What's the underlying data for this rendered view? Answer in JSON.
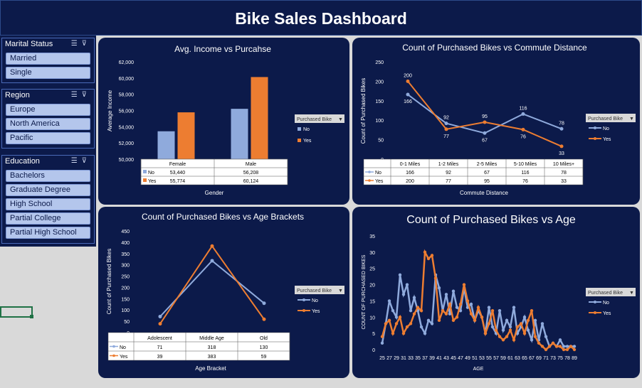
{
  "dashboard": {
    "title": "Bike Sales Dashboard"
  },
  "slicers": [
    {
      "title": "Marital Status",
      "items": [
        "Married",
        "Single"
      ]
    },
    {
      "title": "Region",
      "items": [
        "Europe",
        "North America",
        "Pacific"
      ]
    },
    {
      "title": "Education",
      "items": [
        "Bachelors",
        "Graduate Degree",
        "High School",
        "Partial College",
        "Partial High School"
      ]
    }
  ],
  "legend_button": "Purchased Bike",
  "colors": {
    "no": "#8faadc",
    "yes": "#ed7d31",
    "panel": "#0c1a4a",
    "text": "#ffffff"
  },
  "chart_data": [
    {
      "type": "bar",
      "title": "Avg. Income vs Purcahse",
      "xlabel": "Gender",
      "ylabel": "Average Income",
      "categories": [
        "Female",
        "Male"
      ],
      "series": [
        {
          "name": "No",
          "values": [
            53440,
            56208
          ],
          "labels": [
            "53,440",
            "56,208"
          ]
        },
        {
          "name": "Yes",
          "values": [
            55774,
            60124
          ],
          "labels": [
            "55,774",
            "60,124"
          ]
        }
      ],
      "ylim": [
        50000,
        62000
      ],
      "yticks": [
        "50,000",
        "52,000",
        "54,000",
        "56,000",
        "58,000",
        "60,000",
        "62,000"
      ],
      "legend": "right"
    },
    {
      "type": "line",
      "title": "Count of Purchased Bikes vs Commute Distance",
      "xlabel": "Commute Distance",
      "ylabel": "Count of Purchased Bikes",
      "categories": [
        "0-1 Miles",
        "1-2 Miles",
        "2-5 Miles",
        "5-10 Miles",
        "10 Miles+"
      ],
      "series": [
        {
          "name": "No",
          "values": [
            166,
            92,
            67,
            116,
            78
          ]
        },
        {
          "name": "Yes",
          "values": [
            200,
            77,
            95,
            76,
            33
          ]
        }
      ],
      "ylim": [
        0,
        250
      ],
      "yticks": [
        "0",
        "50",
        "100",
        "150",
        "200",
        "250"
      ],
      "legend": "right"
    },
    {
      "type": "line",
      "title": "Count of Purchased Bikes vs Age Brackets",
      "xlabel": "Age Bracket",
      "ylabel": "Count of Purchased Bikes",
      "categories": [
        "Adolescent",
        "Middle Age",
        "Old"
      ],
      "series": [
        {
          "name": "No",
          "values": [
            71,
            318,
            130
          ]
        },
        {
          "name": "Yes",
          "values": [
            39,
            383,
            59
          ]
        }
      ],
      "ylim": [
        0,
        450
      ],
      "yticks": [
        "0",
        "50",
        "100",
        "150",
        "200",
        "250",
        "300",
        "350",
        "400",
        "450"
      ],
      "legend": "right"
    },
    {
      "type": "line",
      "title": "Count of Purchased Bikes vs Age",
      "xlabel": "AGE",
      "ylabel": "COUNT OF PURCHASED BIKES",
      "x": [
        25,
        26,
        27,
        28,
        29,
        30,
        31,
        32,
        33,
        34,
        35,
        36,
        37,
        38,
        39,
        40,
        41,
        42,
        43,
        44,
        45,
        46,
        47,
        48,
        49,
        50,
        51,
        52,
        53,
        54,
        55,
        56,
        57,
        58,
        59,
        60,
        61,
        62,
        63,
        64,
        65,
        66,
        67,
        68,
        69,
        70,
        71,
        72,
        73,
        74,
        75,
        76,
        77,
        78,
        79,
        80,
        81,
        82,
        83,
        84,
        85,
        86,
        87,
        88,
        89
      ],
      "xticks": [
        "25",
        "27",
        "29",
        "31",
        "33",
        "35",
        "37",
        "39",
        "41",
        "43",
        "45",
        "47",
        "49",
        "51",
        "53",
        "55",
        "57",
        "59",
        "61",
        "63",
        "65",
        "67",
        "69",
        "71",
        "73",
        "75",
        "78",
        "89"
      ],
      "series": [
        {
          "name": "No",
          "values": [
            2,
            8,
            15,
            12,
            10,
            23,
            17,
            20,
            12,
            16,
            12,
            7,
            5,
            9,
            8,
            23,
            19,
            12,
            17,
            11,
            18,
            13,
            12,
            19,
            13,
            14,
            9,
            12,
            10,
            5,
            13,
            7,
            5,
            12,
            6,
            9,
            7,
            13,
            5,
            7,
            10,
            6,
            3,
            9,
            3,
            8,
            4,
            1,
            2,
            1,
            3,
            1,
            1,
            1,
            1
          ]
        },
        {
          "name": "Yes",
          "values": [
            4,
            8,
            9,
            5,
            8,
            10,
            5,
            7,
            8,
            11,
            13,
            12,
            30,
            28,
            29,
            22,
            9,
            12,
            11,
            14,
            9,
            10,
            14,
            20,
            15,
            11,
            9,
            13,
            10,
            5,
            8,
            12,
            6,
            4,
            3,
            4,
            6,
            3,
            7,
            8,
            5,
            9,
            12,
            4,
            2,
            1,
            0,
            1,
            2,
            1,
            1,
            0,
            0,
            1,
            0
          ]
        }
      ],
      "ylim": [
        0,
        35
      ],
      "yticks": [
        "0",
        "5",
        "10",
        "15",
        "20",
        "25",
        "30",
        "35"
      ],
      "legend": "right"
    }
  ]
}
